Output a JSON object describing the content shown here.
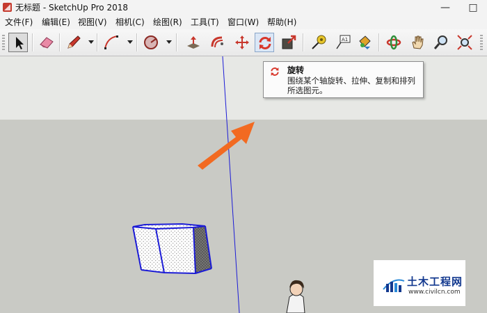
{
  "window": {
    "title": "无标题 - SketchUp Pro 2018",
    "minimize": "—",
    "maximize": "□"
  },
  "menu": [
    "文件(F)",
    "编辑(E)",
    "视图(V)",
    "相机(C)",
    "绘图(R)",
    "工具(T)",
    "窗口(W)",
    "帮助(H)"
  ],
  "toolbar": {
    "tools": [
      {
        "name": "select-tool",
        "icon": "arrow-cursor-icon"
      },
      {
        "name": "eraser-tool",
        "icon": "eraser-icon"
      },
      {
        "name": "line-tool",
        "icon": "pencil-icon"
      },
      {
        "name": "arc-tool",
        "icon": "arc-icon"
      },
      {
        "name": "shape-tool",
        "icon": "circle-shape-icon"
      },
      {
        "name": "push-pull-tool",
        "icon": "push-pull-icon"
      },
      {
        "name": "follow-me-tool",
        "icon": "follow-me-icon"
      },
      {
        "name": "move-tool",
        "icon": "move-arrows-icon"
      },
      {
        "name": "rotate-tool",
        "icon": "rotate-icon"
      },
      {
        "name": "scale-tool",
        "icon": "scale-icon"
      },
      {
        "name": "tape-measure-tool",
        "icon": "tape-measure-icon"
      },
      {
        "name": "text-tool",
        "icon": "text-label-icon"
      },
      {
        "name": "paint-bucket-tool",
        "icon": "paint-bucket-icon"
      },
      {
        "name": "orbit-tool",
        "icon": "orbit-icon"
      },
      {
        "name": "pan-tool",
        "icon": "hand-icon"
      },
      {
        "name": "zoom-tool",
        "icon": "magnifier-icon"
      },
      {
        "name": "zoom-extents-tool",
        "icon": "zoom-extents-icon"
      }
    ]
  },
  "tooltip": {
    "title": "旋转",
    "description": "围绕某个轴旋转、拉伸、复制和排列所选图元。"
  },
  "watermark": {
    "title": "土木工程网",
    "url": "www.civilcn.com"
  },
  "colors": {
    "sky": "#e7e8e5",
    "ground": "#c9cac5",
    "axis_blue": "#1b1bd6",
    "arrow_orange": "#f26a21",
    "rotate_red": "#d8362a",
    "watermark_blue": "#13398f"
  }
}
